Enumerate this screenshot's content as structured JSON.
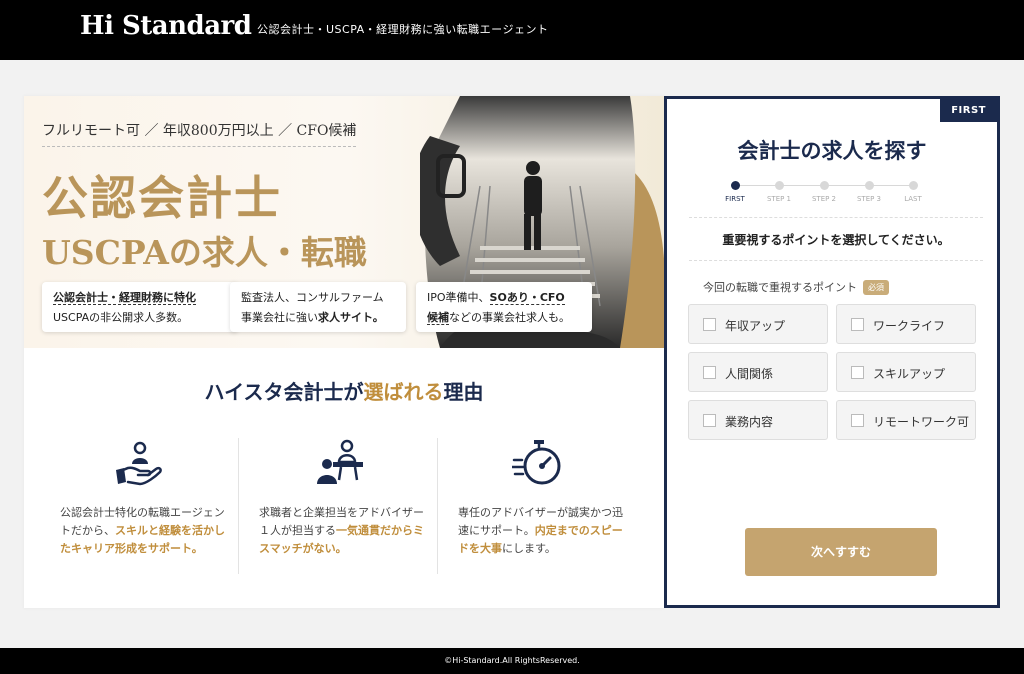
{
  "header": {
    "logo": "Hi Standard",
    "tagline": "公認会計士・USCPA・経理財務に強い転職エージェント"
  },
  "hero": {
    "sub": "フルリモート可 ／ 年収800万円以上 ／ CFO候補",
    "title_line1": "公認会計士",
    "title_line2": "USCPAの求人・転職",
    "features": [
      {
        "line1": "公認会計士・経理財務に特化",
        "line2": "USCPAの非公開求人多数。"
      },
      {
        "line1": "監査法人、コンサルファーム",
        "line2a": "事業会社に強い",
        "line2b": "求人サイト。"
      },
      {
        "line1a": "IPO準備中、",
        "line1b": "SOあり・CFO",
        "line2a": "候補",
        "line2b": "などの事業会社求人も。"
      }
    ]
  },
  "why": {
    "part1": "ハイスタ会計士が",
    "part2": "選ばれる",
    "part3": "理由"
  },
  "reasons": [
    {
      "icon": "hand-person-icon",
      "a": "公認会計士特化の転職エージェントだから、",
      "b": "スキルと経験を活かしたキャリア形成をサポート。"
    },
    {
      "icon": "advisor-meeting-icon",
      "a": "求職者と企業担当をアドバイザー１人が担当する",
      "b": "一気通貫だからミスマッチがない。"
    },
    {
      "icon": "speed-stopwatch-icon",
      "a": "専任のアドバイザーが誠実かつ迅速にサポート。",
      "b": "内定までのスピードを大事",
      "c": "にします。"
    }
  ],
  "panel": {
    "badge": "FIRST",
    "title": "会計士の求人を探す",
    "steps": [
      "FIRST",
      "STEP 1",
      "STEP 2",
      "STEP 3",
      "LAST"
    ],
    "instruction": "重要視するポイントを選択してください。",
    "question": "今回の転職で重視するポイント",
    "required": "必須",
    "options": [
      "年収アップ",
      "ワークライフ",
      "人間関係",
      "スキルアップ",
      "業務内容",
      "リモートワーク可"
    ],
    "next_button": "次へすすむ"
  },
  "footer": {
    "copyright": "©Hi-Standard.All RightsReserved."
  },
  "colors": {
    "navy": "#1b2a4d",
    "gold": "#b9955a",
    "accent": "#c08e3c",
    "button": "#c5a46f"
  }
}
